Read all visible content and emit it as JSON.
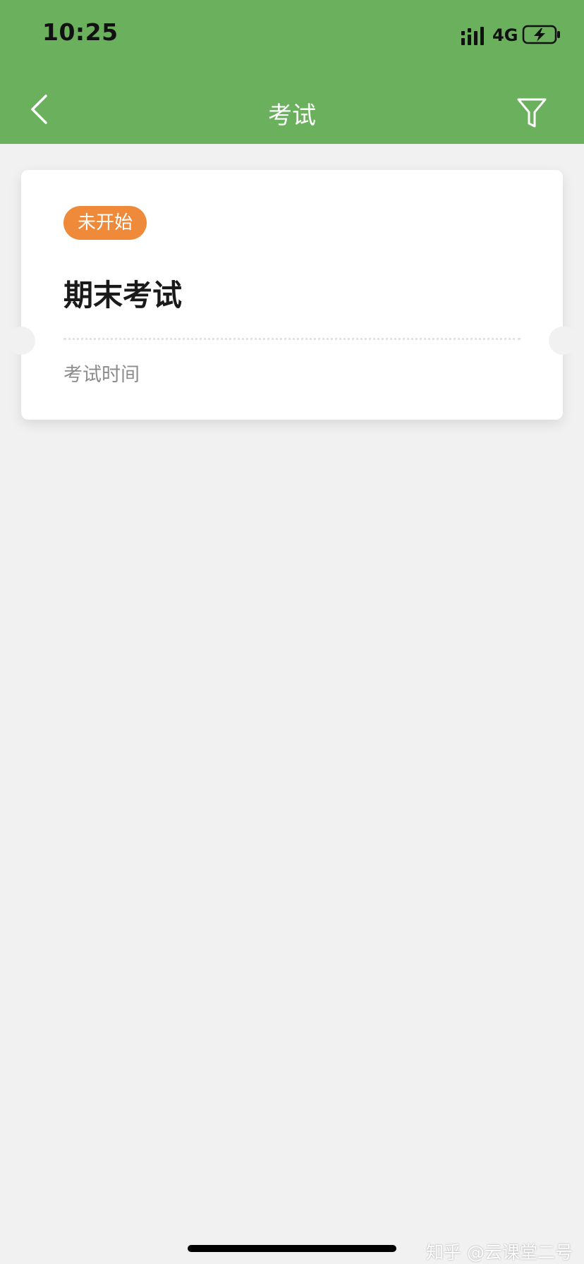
{
  "status_bar": {
    "time": "10:25",
    "network": "4G",
    "icons": [
      "signal-icon",
      "battery-charging-icon"
    ]
  },
  "nav": {
    "title": "考试",
    "back_icon": "chevron-left-icon",
    "filter_icon": "filter-icon"
  },
  "exam_card": {
    "status": "未开始",
    "title": "期末考试",
    "time_label": "考试时间"
  },
  "watermark": "知乎 @云课堂二号",
  "colors": {
    "header": "#6ab05d",
    "badge": "#ee8a3a",
    "background": "#f1f1f1"
  }
}
